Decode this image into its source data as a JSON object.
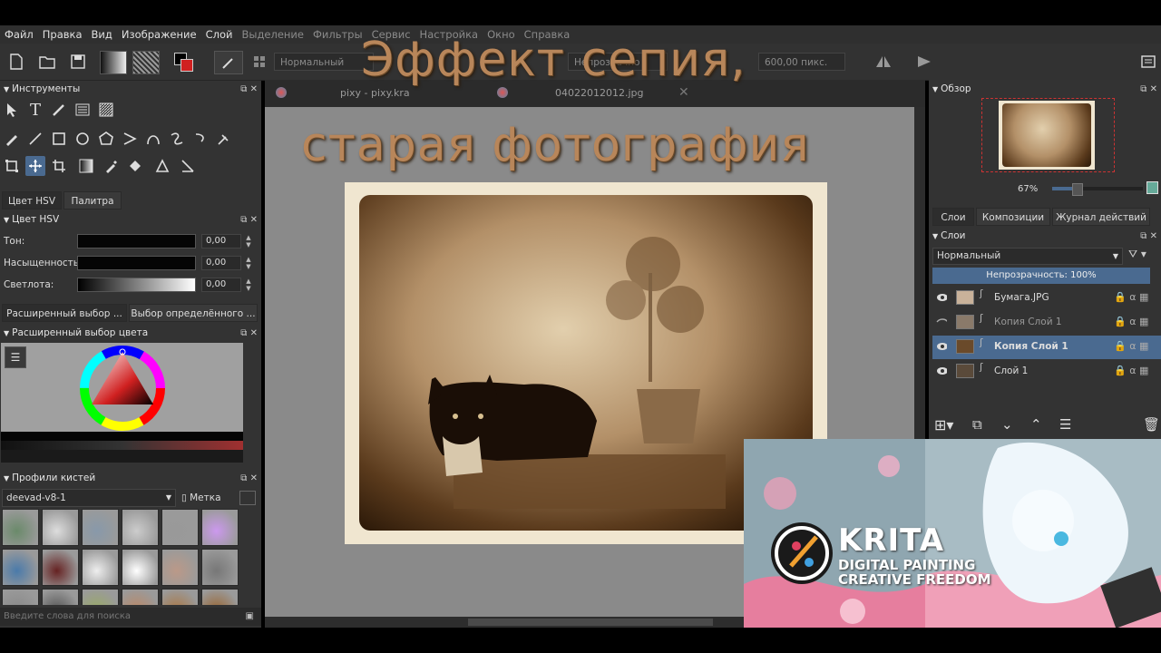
{
  "menu": [
    "Файл",
    "Правка",
    "Вид",
    "Изображение",
    "Слой",
    "Выделение",
    "Фильтры",
    "Сервис",
    "Настройка",
    "Окно",
    "Справка"
  ],
  "menu_dim_from": 5,
  "toolbar": {
    "blend_mode": "Нормальный",
    "opacity_label": "Непрозрачно",
    "size_value": "600,00 пикс."
  },
  "doc_tabs": [
    "pixy - pixy.kra",
    "04022012012.jpg"
  ],
  "tools_panel": {
    "title": "Инструменты"
  },
  "color_tabs": [
    "Цвет HSV",
    "Палитра"
  ],
  "hsv": {
    "title": "Цвет HSV",
    "rows": [
      {
        "label": "Тон:",
        "value": "0,00"
      },
      {
        "label": "Насыщенность:",
        "value": "0,00"
      },
      {
        "label": "Светлота:",
        "value": "0,00"
      }
    ]
  },
  "selector_tabs": [
    "Расширенный выбор ...",
    "Выбор определённого ..."
  ],
  "adv_color": {
    "title": "Расширенный выбор цвета"
  },
  "brushes": {
    "title": "Профили кистей",
    "preset": "deevad-v8-1",
    "tag": "Метка",
    "search_placeholder": "Введите слова для поиска"
  },
  "overview": {
    "title": "Обзор",
    "zoom": "67%"
  },
  "layers_tabs": [
    "Слои",
    "Композиции",
    "Журнал действий"
  ],
  "layers": {
    "title": "Слои",
    "blend": "Нормальный",
    "opacity": "Непрозрачность:  100%",
    "items": [
      {
        "name": "Бумага.JPG",
        "visible": true,
        "selected": false
      },
      {
        "name": "Копия  Слой 1",
        "visible": false,
        "selected": false
      },
      {
        "name": "Копия  Слой 1",
        "visible": true,
        "selected": true
      },
      {
        "name": "Слой 1",
        "visible": true,
        "selected": false
      }
    ]
  },
  "overlay": {
    "line1": "Эффект сепия,",
    "line2": "старая фотография"
  },
  "banner": {
    "logo": "KRITA",
    "line1": "DIGITAL PAINTING",
    "line2": "CREATIVE FREEDOM"
  },
  "colors": {
    "accent": "#4a6a90",
    "sepia": "#b8865a",
    "panel": "#333333"
  }
}
